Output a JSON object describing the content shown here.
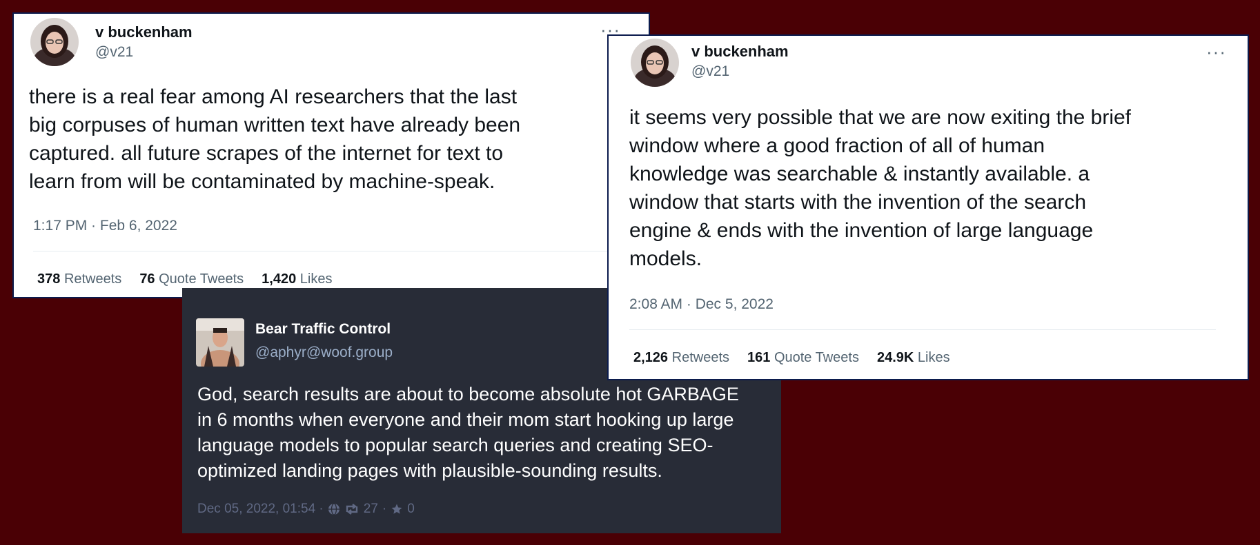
{
  "tweet1": {
    "name": "v buckenham",
    "handle": "@v21",
    "more": "···",
    "lines": [
      "there is a real fear among AI researchers that the last",
      "big corpuses of human written text have already been",
      "captured. all future scrapes of the internet for text to",
      "learn from will be contaminated by machine-speak."
    ],
    "time": "1:17 PM · Feb 6, 2022",
    "retweets_count": "378",
    "retweets_label": "Retweets",
    "quotes_count": "76",
    "quotes_label": "Quote Tweets",
    "likes_count": "1,420",
    "likes_label": "Likes"
  },
  "toot": {
    "name": "Bear Traffic Control",
    "handle": "@aphyr@woof.group",
    "lines": [
      "God, search results are about to become absolute hot GARBAGE",
      "in 6 months when everyone and their mom start hooking up large",
      "language models to popular search queries and creating SEO-",
      "optimized landing pages with plausible-sounding results."
    ],
    "time": "Dec 05, 2022, 01:54 ·",
    "boosts": "27",
    "favs": "0",
    "separator": "·"
  },
  "tweet2": {
    "name": "v buckenham",
    "handle": "@v21",
    "more": "···",
    "lines": [
      "it seems very possible that we are now exiting the brief",
      "window where a good fraction of all of human",
      "knowledge was searchable & instantly available. a",
      "window that starts with the invention of the search",
      "engine & ends with the invention of large language",
      "models."
    ],
    "time": "2:08 AM · Dec 5, 2022",
    "retweets_count": "2,126",
    "retweets_label": "Retweets",
    "quotes_count": "161",
    "quotes_label": "Quote Tweets",
    "likes_count": "24.9K",
    "likes_label": "Likes"
  },
  "colors": {
    "background": "#4a0005",
    "tweet_bg": "#ffffff",
    "toot_bg": "#282c37",
    "border": "#0b1b4d"
  }
}
